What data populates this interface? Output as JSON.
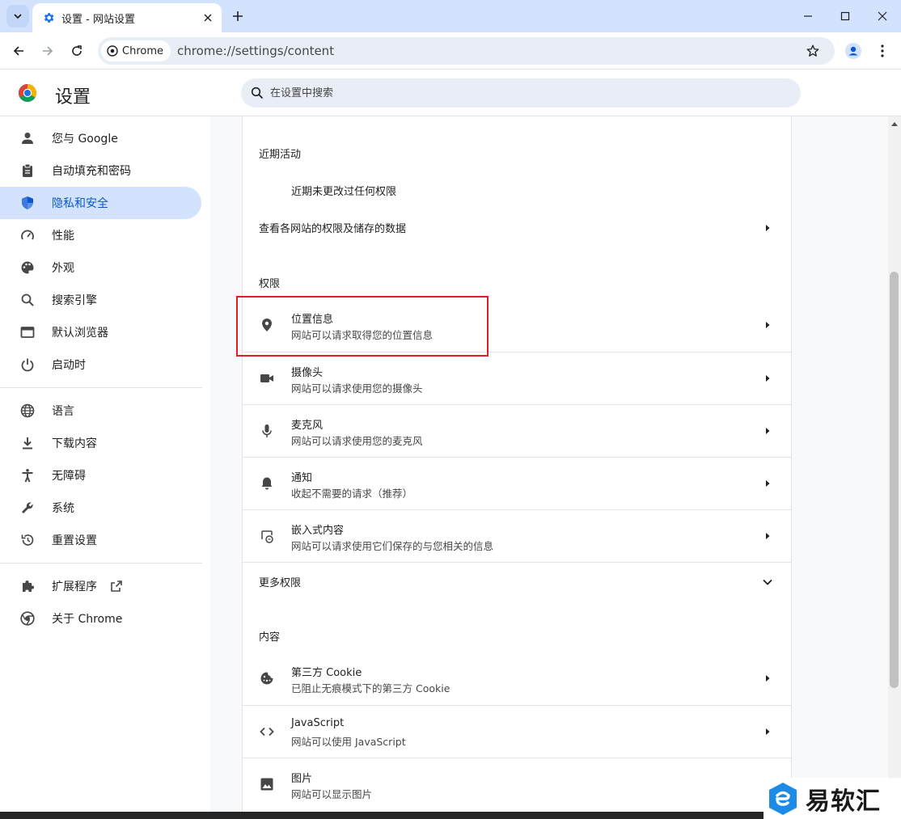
{
  "browser": {
    "tab_title": "设置 - 网站设置",
    "url": "chrome://settings/content",
    "chip_label": "Chrome"
  },
  "header": {
    "title": "设置",
    "search_placeholder": "在设置中搜索"
  },
  "sidebar": {
    "items": [
      {
        "label": "您与 Google",
        "icon": "person-icon"
      },
      {
        "label": "自动填充和密码",
        "icon": "clipboard-icon"
      },
      {
        "label": "隐私和安全",
        "icon": "shield-icon",
        "active": true
      },
      {
        "label": "性能",
        "icon": "speedometer-icon"
      },
      {
        "label": "外观",
        "icon": "palette-icon"
      },
      {
        "label": "搜索引擎",
        "icon": "search-icon"
      },
      {
        "label": "默认浏览器",
        "icon": "browser-icon"
      },
      {
        "label": "启动时",
        "icon": "power-icon"
      },
      {
        "label": "语言",
        "icon": "globe-icon"
      },
      {
        "label": "下载内容",
        "icon": "download-icon"
      },
      {
        "label": "无障碍",
        "icon": "accessibility-icon"
      },
      {
        "label": "系统",
        "icon": "wrench-icon"
      },
      {
        "label": "重置设置",
        "icon": "reset-icon"
      },
      {
        "label": "扩展程序",
        "icon": "puzzle-icon"
      },
      {
        "label": "关于 Chrome",
        "icon": "chrome-icon"
      }
    ]
  },
  "main": {
    "recent": {
      "title": "近期活动",
      "empty_text": "近期未更改过任何权限",
      "view_all": "查看各网站的权限及储存的数据"
    },
    "permissions": {
      "title": "权限",
      "items": [
        {
          "title": "位置信息",
          "subtitle": "网站可以请求取得您的位置信息",
          "icon": "location-pin-icon"
        },
        {
          "title": "摄像头",
          "subtitle": "网站可以请求使用您的摄像头",
          "icon": "camera-icon"
        },
        {
          "title": "麦克风",
          "subtitle": "网站可以请求使用您的麦克风",
          "icon": "microphone-icon"
        },
        {
          "title": "通知",
          "subtitle": "收起不需要的请求（推荐）",
          "icon": "bell-icon"
        },
        {
          "title": "嵌入式内容",
          "subtitle": "网站可以请求使用它们保存的与您相关的信息",
          "icon": "embedded-content-icon"
        }
      ],
      "more": "更多权限"
    },
    "content": {
      "title": "内容",
      "items": [
        {
          "title": "第三方 Cookie",
          "subtitle": "已阻止无痕模式下的第三方 Cookie",
          "icon": "cookie-icon"
        },
        {
          "title": "JavaScript",
          "subtitle": "网站可以使用 JavaScript",
          "icon": "code-icon"
        },
        {
          "title": "图片",
          "subtitle": "网站可以显示图片",
          "icon": "image-icon"
        }
      ]
    }
  },
  "watermark": {
    "text": "易软汇"
  },
  "colors": {
    "accent": "#0b57d0",
    "active_bg": "#d3e3fd",
    "highlight": "#e02020"
  }
}
